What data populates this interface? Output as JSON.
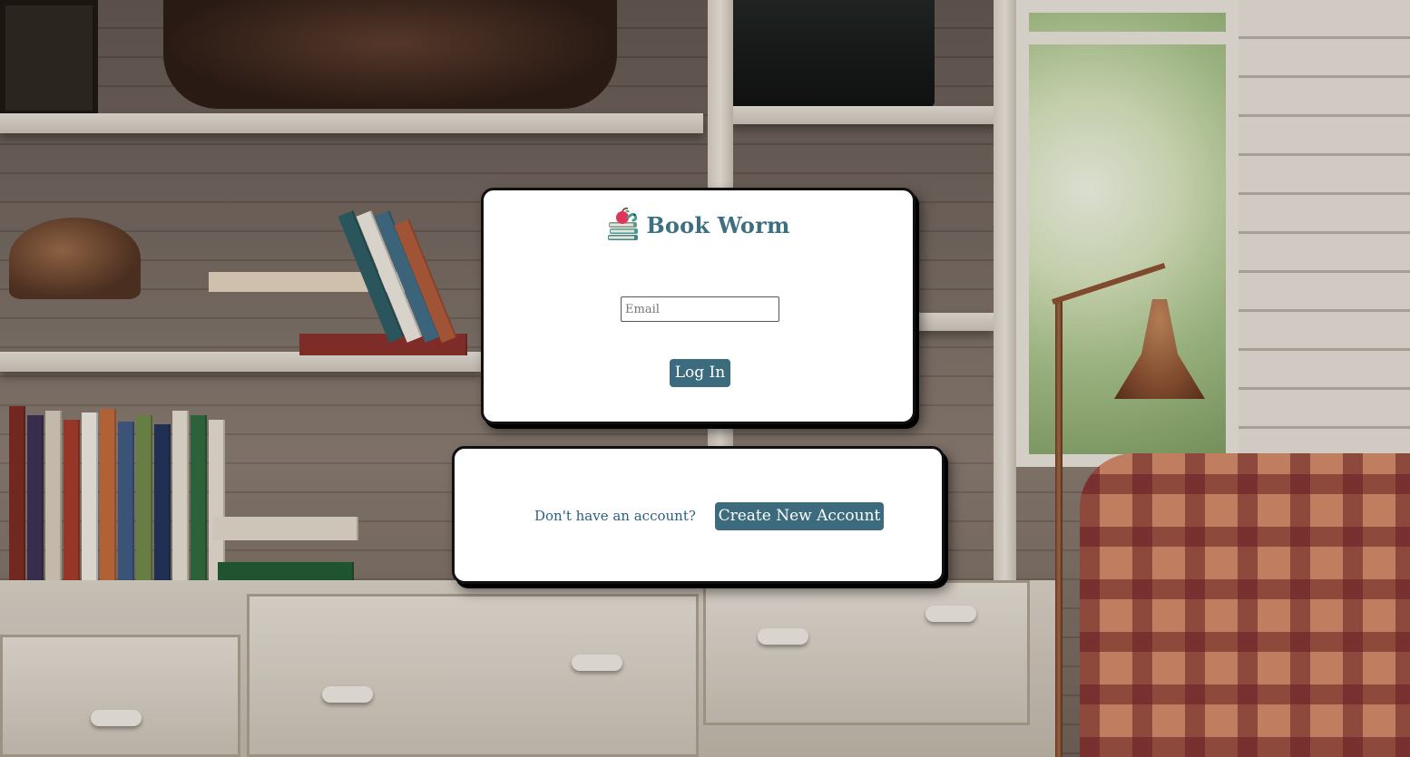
{
  "app": {
    "title": "Book Worm",
    "logo_icon": "book-stack-worm-icon"
  },
  "login": {
    "email_placeholder": "Email",
    "email_value": "",
    "login_label": "Log In"
  },
  "signup": {
    "prompt": "Don't have an account?",
    "create_label": "Create New Account"
  },
  "colors": {
    "accent": "#3c6b7d",
    "brand_text": "#3d6f80",
    "prompt_text": "#2a5f80",
    "card_background": "#ffffff",
    "card_border": "#111111"
  },
  "background": {
    "description_icon": "room-bookshelf-photo"
  }
}
